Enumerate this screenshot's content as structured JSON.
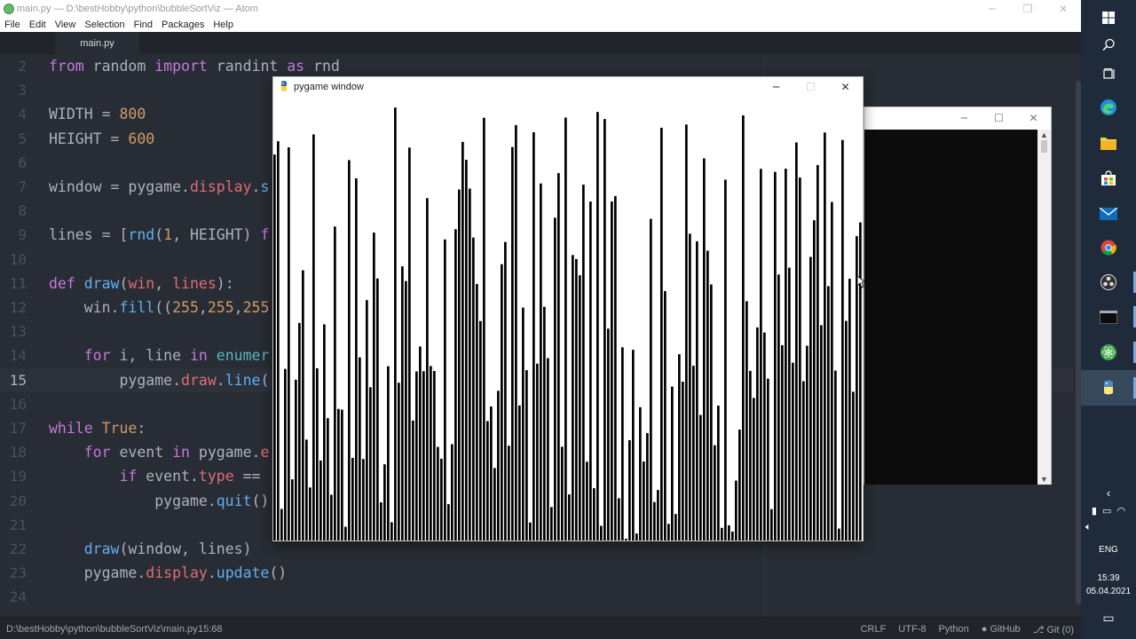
{
  "atom": {
    "title": "main.py — D:\\bestHobby\\python\\bubbleSortViz — Atom",
    "menu": [
      "File",
      "Edit",
      "View",
      "Selection",
      "Find",
      "Packages",
      "Help"
    ],
    "tab": "main.py",
    "lines": [
      {
        "n": "2",
        "html": "<span class='k'>from</span> random <span class='k'>import</span> randint <span class='k'>as</span> rnd"
      },
      {
        "n": "3",
        "html": ""
      },
      {
        "n": "4",
        "html": "WIDTH = <span class='n'>800</span>"
      },
      {
        "n": "5",
        "html": "HEIGHT = <span class='n'>600</span>"
      },
      {
        "n": "6",
        "html": ""
      },
      {
        "n": "7",
        "html": "window = pygame.<span class='m'>display</span>.<span class='f'>s</span>"
      },
      {
        "n": "8",
        "html": ""
      },
      {
        "n": "9",
        "html": "lines = [<span class='f'>rnd</span>(<span class='n'>1</span>, HEIGHT) <span class='k'>f</span>"
      },
      {
        "n": "10",
        "html": ""
      },
      {
        "n": "11",
        "html": "<span class='k'>def</span> <span class='f'>draw</span>(<span class='m'>win</span>, <span class='m'>lines</span>):"
      },
      {
        "n": "12",
        "html": "    win.<span class='f'>fill</span>((<span class='n'>255</span>,<span class='n'>255</span>,<span class='n'>255</span>"
      },
      {
        "n": "13",
        "html": ""
      },
      {
        "n": "14",
        "html": "    <span class='k'>for</span> i, line <span class='k'>in</span> <span class='c'>enumer</span>"
      },
      {
        "n": "15",
        "html": "        pygame.<span class='m'>draw</span>.<span class='f'>line</span>(",
        "active": true
      },
      {
        "n": "16",
        "html": ""
      },
      {
        "n": "17",
        "html": "<span class='k'>while</span> <span class='n'>True</span>:"
      },
      {
        "n": "18",
        "html": "    <span class='k'>for</span> event <span class='k'>in</span> pygame.<span class='m'>e</span>"
      },
      {
        "n": "19",
        "html": "        <span class='k'>if</span> event.<span class='m'>type</span> =="
      },
      {
        "n": "20",
        "html": "            pygame.<span class='f'>quit</span>()"
      },
      {
        "n": "21",
        "html": ""
      },
      {
        "n": "22",
        "html": "    <span class='f'>draw</span>(window, lines)"
      },
      {
        "n": "23",
        "html": "    pygame.<span class='m'>display</span>.<span class='f'>update</span>()"
      },
      {
        "n": "24",
        "html": ""
      }
    ],
    "status": {
      "path": "D:\\bestHobby\\python\\bubbleSortViz\\main.py",
      "cursor": "15:68",
      "line_ending": "CRLF",
      "encoding": "UTF-8",
      "grammar": "Python",
      "github": "GitHub",
      "git": "Git (0)"
    }
  },
  "pygame": {
    "title": "pygame window",
    "seed": 17,
    "line_count": 166,
    "background": "#ffffff",
    "line_color": "#000000"
  },
  "taskbar": {
    "lang": "ENG",
    "time": "15:39",
    "date": "05.04.2021"
  },
  "colors": {
    "editor_bg": "#282c34",
    "keyword": "#c678dd",
    "function": "#61afef",
    "number": "#d19a66",
    "attribute": "#e06c75",
    "builtin": "#56b6c2"
  }
}
